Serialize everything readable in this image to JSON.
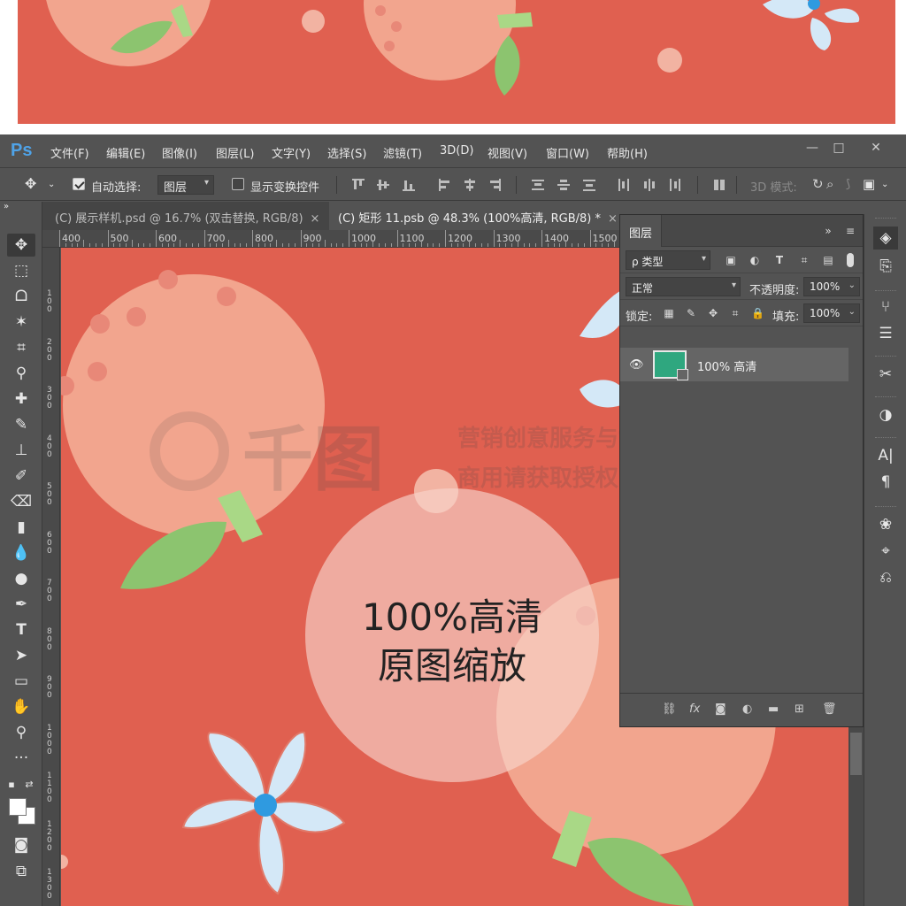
{
  "app": {
    "logo": "Ps"
  },
  "menu": [
    "文件(F)",
    "编辑(E)",
    "图像(I)",
    "图层(L)",
    "文字(Y)",
    "选择(S)",
    "滤镜(T)",
    "3D(D)",
    "视图(V)",
    "窗口(W)",
    "帮助(H)"
  ],
  "window_controls": {
    "minimize": "—",
    "maximize": "□",
    "close": "✕"
  },
  "options": {
    "auto_select_label": "自动选择:",
    "auto_select_value": "图层",
    "auto_select_checked": true,
    "show_transform_label": "显示变换控件",
    "show_transform_checked": false,
    "mode_label": "3D 模式:"
  },
  "tabs": [
    {
      "label": "(C) 展示样机.psd @ 16.7% (双击替换, RGB/8)",
      "close": "×",
      "active": false
    },
    {
      "label": "(C) 矩形 11.psb @ 48.3% (100%高清, RGB/8) *",
      "close": "×",
      "active": true
    }
  ],
  "ruler": {
    "h_ticks": [
      "400",
      "500",
      "600",
      "700",
      "800",
      "900",
      "1000",
      "1100",
      "1200",
      "1300",
      "1400",
      "1500"
    ],
    "v_ticks": [
      "100",
      "200",
      "300",
      "400",
      "500",
      "600",
      "700",
      "800",
      "900",
      "1000",
      "1100",
      "1200",
      "1300"
    ]
  },
  "layers_panel": {
    "title": "图层",
    "filter_value": "ρ 类型",
    "blend_mode": "正常",
    "opacity_label": "不透明度:",
    "opacity_value": "100%",
    "lock_label": "锁定:",
    "fill_label": "填充:",
    "fill_value": "100%",
    "layer_name": "100% 高清",
    "layer_thumb_color": "#2fa77f",
    "footer_icons": [
      "link-icon",
      "fx-icon",
      "mask-icon",
      "adjustment-icon",
      "folder-icon",
      "new-layer-icon",
      "trash-icon"
    ],
    "fx_text": "fx"
  },
  "canvas": {
    "background": "#e06050",
    "caption_line1": "100%高清",
    "caption_line2": "原图缩放",
    "watermark_brand": "千图",
    "watermark_line1": "营销创意服务与协作平台",
    "watermark_line2": "商用请获取授权"
  },
  "colors": {
    "accent_blue": "#4fa3e8",
    "peach": "#f2a58e",
    "leaf": "#8cc46f",
    "flower": "#d4e8f7"
  }
}
